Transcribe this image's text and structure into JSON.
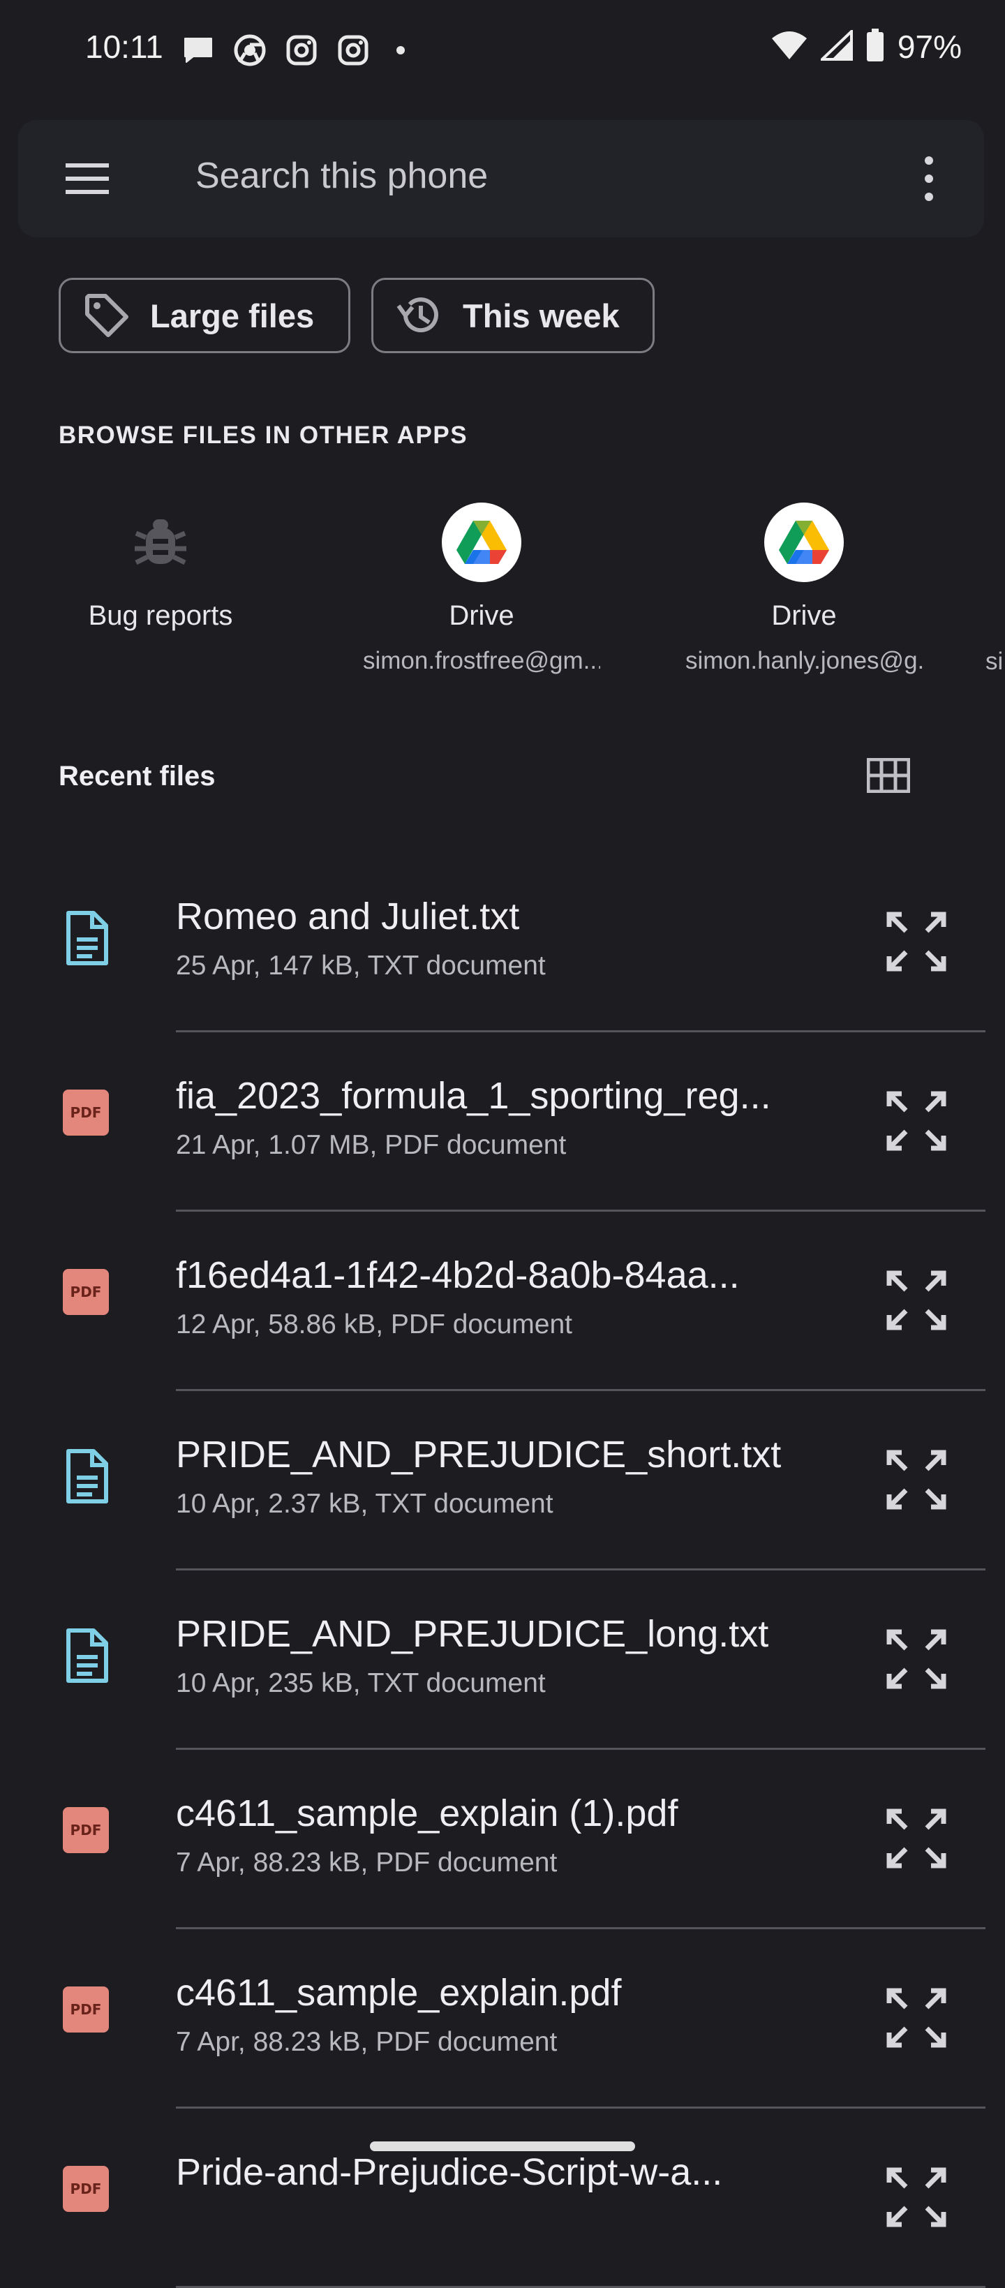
{
  "status_bar": {
    "time": "10:11",
    "battery": "97%",
    "icons_left": [
      "chat-icon",
      "chrome-icon",
      "instagram-icon",
      "instagram-icon",
      "dot-icon"
    ],
    "icons_right": [
      "wifi-icon",
      "signal-icon",
      "battery-icon"
    ]
  },
  "search": {
    "placeholder": "Search this phone"
  },
  "chips": [
    {
      "label": "Large files",
      "icon": "tag-icon"
    },
    {
      "label": "This week",
      "icon": "history-icon"
    }
  ],
  "browse": {
    "title": "BROWSE FILES IN OTHER APPS",
    "apps": [
      {
        "name": "Bug reports",
        "sub": "",
        "icon": "bug-icon"
      },
      {
        "name": "Drive",
        "sub": "simon.frostfree@gm...",
        "icon": "google-drive-icon"
      },
      {
        "name": "Drive",
        "sub": "simon.hanly.jones@g...",
        "icon": "google-drive-icon"
      },
      {
        "name": "",
        "sub": "si",
        "icon": ""
      }
    ]
  },
  "recent": {
    "title": "Recent files",
    "files": [
      {
        "name": "Romeo and Juliet.txt",
        "meta": "25 Apr, 147 kB, TXT document",
        "type": "txt"
      },
      {
        "name": "fia_2023_formula_1_sporting_reg...",
        "meta": "21 Apr, 1.07 MB, PDF document",
        "type": "pdf"
      },
      {
        "name": "f16ed4a1-1f42-4b2d-8a0b-84aa...",
        "meta": "12 Apr, 58.86 kB, PDF document",
        "type": "pdf"
      },
      {
        "name": "PRIDE_AND_PREJUDICE_short.txt",
        "meta": "10 Apr, 2.37 kB, TXT document",
        "type": "txt"
      },
      {
        "name": "PRIDE_AND_PREJUDICE_long.txt",
        "meta": "10 Apr, 235 kB, TXT document",
        "type": "txt"
      },
      {
        "name": "c4611_sample_explain (1).pdf",
        "meta": "7 Apr, 88.23 kB, PDF document",
        "type": "pdf"
      },
      {
        "name": "c4611_sample_explain.pdf",
        "meta": "7 Apr, 88.23 kB, PDF document",
        "type": "pdf"
      },
      {
        "name": "Pride-and-Prejudice-Script-w-a...",
        "meta": "",
        "type": "pdf"
      }
    ]
  },
  "pdf_badge_text": "PDF",
  "colors": {
    "background": "#1d1d21",
    "text_icon": "#7fd0e6",
    "pdf_icon": "#e3877c"
  }
}
